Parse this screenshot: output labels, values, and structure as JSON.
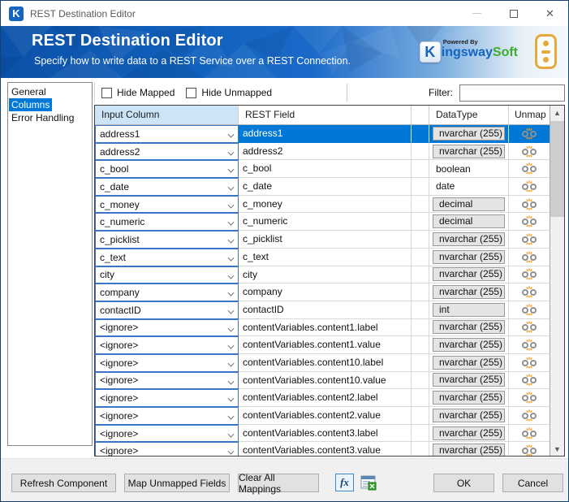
{
  "window": {
    "title": "REST Destination Editor"
  },
  "titlebar_icons": {
    "app_icon_letter": "K",
    "close_glyph": "✕"
  },
  "header": {
    "title": "REST Destination Editor",
    "subtitle": "Specify how to write data to a REST Service over a REST Connection.",
    "logo": {
      "badge_letter": "K",
      "powered_by": "Powered By",
      "brand_blue": "ingsway",
      "brand_green": "Soft"
    }
  },
  "sidebar": {
    "items": [
      {
        "label": "General",
        "selected": false
      },
      {
        "label": "Columns",
        "selected": true
      },
      {
        "label": "Error Handling",
        "selected": false
      }
    ]
  },
  "toolbar": {
    "checkboxes": [
      {
        "label": "Hide Mapped",
        "checked": false
      },
      {
        "label": "Hide Unmapped",
        "checked": false
      }
    ],
    "filter_label": "Filter:",
    "filter_value": ""
  },
  "grid": {
    "columns": {
      "input": "Input Column",
      "rest": "REST Field",
      "type": "DataType",
      "unmap": "Unmap"
    },
    "rows": [
      {
        "input": "address1",
        "rest": "address1",
        "type": "nvarchar (255)",
        "type_boxed": true,
        "selected": true
      },
      {
        "input": "address2",
        "rest": "address2",
        "type": "nvarchar (255)",
        "type_boxed": true,
        "selected": false
      },
      {
        "input": "c_bool",
        "rest": "c_bool",
        "type": "boolean",
        "type_boxed": false,
        "selected": false
      },
      {
        "input": "c_date",
        "rest": "c_date",
        "type": "date",
        "type_boxed": false,
        "selected": false
      },
      {
        "input": "c_money",
        "rest": "c_money",
        "type": "decimal",
        "type_boxed": true,
        "selected": false
      },
      {
        "input": "c_numeric",
        "rest": "c_numeric",
        "type": "decimal",
        "type_boxed": true,
        "selected": false
      },
      {
        "input": "c_picklist",
        "rest": "c_picklist",
        "type": "nvarchar (255)",
        "type_boxed": true,
        "selected": false
      },
      {
        "input": "c_text",
        "rest": "c_text",
        "type": "nvarchar (255)",
        "type_boxed": true,
        "selected": false
      },
      {
        "input": "city",
        "rest": "city",
        "type": "nvarchar (255)",
        "type_boxed": true,
        "selected": false
      },
      {
        "input": "company",
        "rest": "company",
        "type": "nvarchar (255)",
        "type_boxed": true,
        "selected": false
      },
      {
        "input": "contactID",
        "rest": "contactID",
        "type": "int",
        "type_boxed": true,
        "selected": false
      },
      {
        "input": "<ignore>",
        "rest": "contentVariables.content1.label",
        "type": "nvarchar (255)",
        "type_boxed": true,
        "selected": false
      },
      {
        "input": "<ignore>",
        "rest": "contentVariables.content1.value",
        "type": "nvarchar (255)",
        "type_boxed": true,
        "selected": false
      },
      {
        "input": "<ignore>",
        "rest": "contentVariables.content10.label",
        "type": "nvarchar (255)",
        "type_boxed": true,
        "selected": false
      },
      {
        "input": "<ignore>",
        "rest": "contentVariables.content10.value",
        "type": "nvarchar (255)",
        "type_boxed": true,
        "selected": false
      },
      {
        "input": "<ignore>",
        "rest": "contentVariables.content2.label",
        "type": "nvarchar (255)",
        "type_boxed": true,
        "selected": false
      },
      {
        "input": "<ignore>",
        "rest": "contentVariables.content2.value",
        "type": "nvarchar (255)",
        "type_boxed": true,
        "selected": false
      },
      {
        "input": "<ignore>",
        "rest": "contentVariables.content3.label",
        "type": "nvarchar (255)",
        "type_boxed": true,
        "selected": false
      },
      {
        "input": "<ignore>",
        "rest": "contentVariables.content3.value",
        "type": "nvarchar (255)",
        "type_boxed": true,
        "selected": false
      }
    ]
  },
  "footer": {
    "refresh_label": "Refresh Component",
    "map_label": "Map Unmapped Fields",
    "clear_label": "Clear All Mappings",
    "fx_label": "fx",
    "ok_label": "OK",
    "cancel_label": "Cancel"
  },
  "colors": {
    "accent_blue": "#0078d7",
    "header_blue": "#1161be",
    "combo_border": "#3d73c8",
    "brand_blue": "#1464c0",
    "brand_green": "#3dae2b",
    "traffic_gold": "#e7a93c",
    "unmap_spark_orange": "#f29b1d"
  }
}
